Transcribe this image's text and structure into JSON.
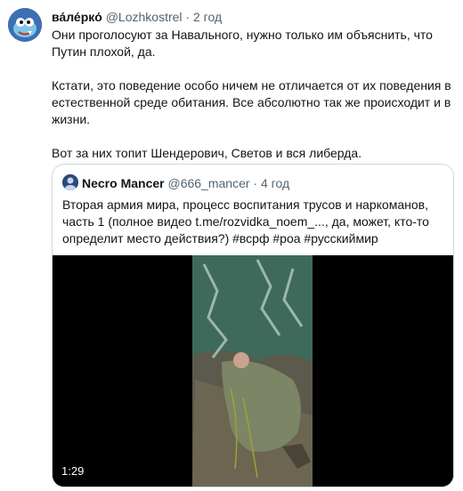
{
  "tweet": {
    "author_name": "ва́ле́ркό",
    "author_handle": "@Lozhkostrel",
    "separator": "·",
    "time": "2 год",
    "paragraphs": [
      "Они проголосуют за Навального, нужно только им объяснить, что Путин плохой, да.",
      "Кстати, это поведение особо ничем не отличается от их поведения в естественной среде обитания. Все абсолютно так же происходит и в жизни.",
      "Вот за них топит Шендерович, Светов и вся либерда."
    ]
  },
  "quoted": {
    "author_name": "Necro Mancer",
    "author_handle": "@666_mancer",
    "separator": "·",
    "time": "4 год",
    "text": "Вторая армия мира, процесс воспитания трусов и наркоманов, часть 1 (полное видео t.me/rozvidka_noem_..., да, может, кто-то определит место действия?) #всрф #роа #русскиймир",
    "video_duration": "1:29"
  }
}
